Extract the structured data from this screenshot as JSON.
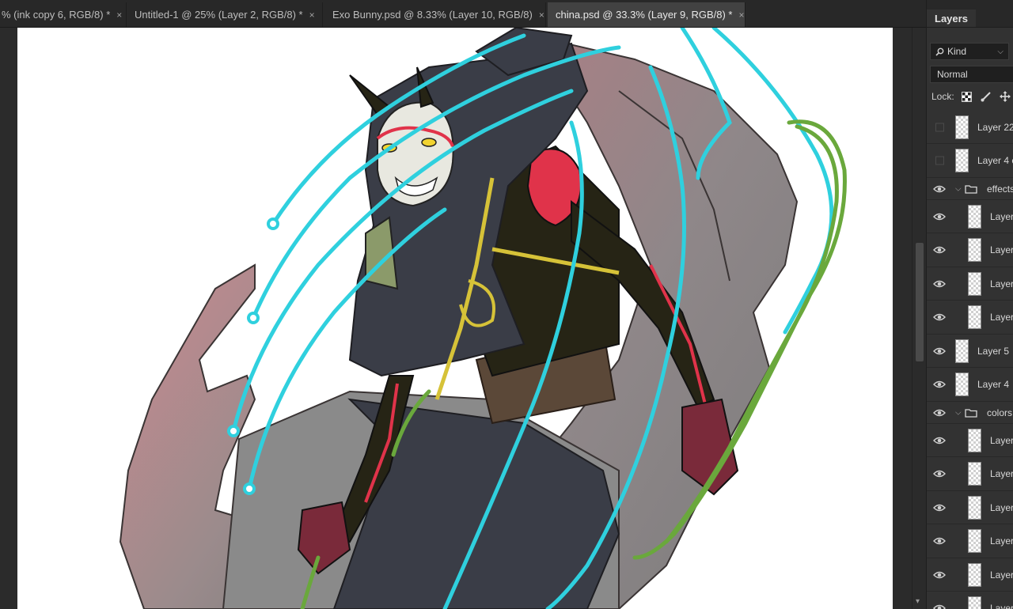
{
  "tabs": [
    {
      "label": "% (ink copy 6, RGB/8) *",
      "close": "×",
      "active": false
    },
    {
      "label": "Untitled-1 @ 25% (Layer 2, RGB/8) *",
      "close": "×",
      "active": false
    },
    {
      "label": "Exo Bunny.psd @ 8.33% (Layer 10, RGB/8)",
      "close": "×",
      "active": false
    },
    {
      "label": "china.psd @ 33.3% (Layer 9, RGB/8) *",
      "close": "×",
      "active": true
    }
  ],
  "panel": {
    "title": "Layers",
    "filter_label": "Kind",
    "blend_mode": "Normal",
    "lock_label": "Lock:",
    "layers": [
      {
        "name": "Layer 22",
        "visible": false,
        "type": "layer",
        "indent": 0
      },
      {
        "name": "Layer 4 c",
        "visible": false,
        "type": "layer",
        "indent": 0
      },
      {
        "name": "effects",
        "visible": true,
        "type": "group",
        "indent": 0
      },
      {
        "name": "Layer",
        "visible": true,
        "type": "layer",
        "indent": 1
      },
      {
        "name": "Layer",
        "visible": true,
        "type": "layer",
        "indent": 1
      },
      {
        "name": "Layer",
        "visible": true,
        "type": "layer",
        "indent": 1
      },
      {
        "name": "Layer",
        "visible": true,
        "type": "layer",
        "indent": 1
      },
      {
        "name": "Layer 5",
        "visible": true,
        "type": "layer",
        "indent": 0
      },
      {
        "name": "Layer 4",
        "visible": true,
        "type": "layer",
        "indent": 0
      },
      {
        "name": "colors",
        "visible": true,
        "type": "group",
        "indent": 0
      },
      {
        "name": "Layer",
        "visible": true,
        "type": "layer",
        "indent": 1
      },
      {
        "name": "Layer",
        "visible": true,
        "type": "layer",
        "indent": 1
      },
      {
        "name": "Layer",
        "visible": true,
        "type": "layer",
        "indent": 1
      },
      {
        "name": "Layer",
        "visible": true,
        "type": "layer",
        "indent": 1
      },
      {
        "name": "Layer",
        "visible": true,
        "type": "layer",
        "indent": 1
      },
      {
        "name": "Layer",
        "visible": true,
        "type": "layer",
        "indent": 1
      }
    ]
  },
  "colors": {
    "stroke_cyan": "#2fd0de",
    "stroke_green": "#6aa83c",
    "wing_pink": "#c98a8f",
    "cloak": "#3a3d47",
    "skin_dark": "#262415",
    "accent_red": "#e0334a",
    "rope_yellow": "#d6c238"
  }
}
